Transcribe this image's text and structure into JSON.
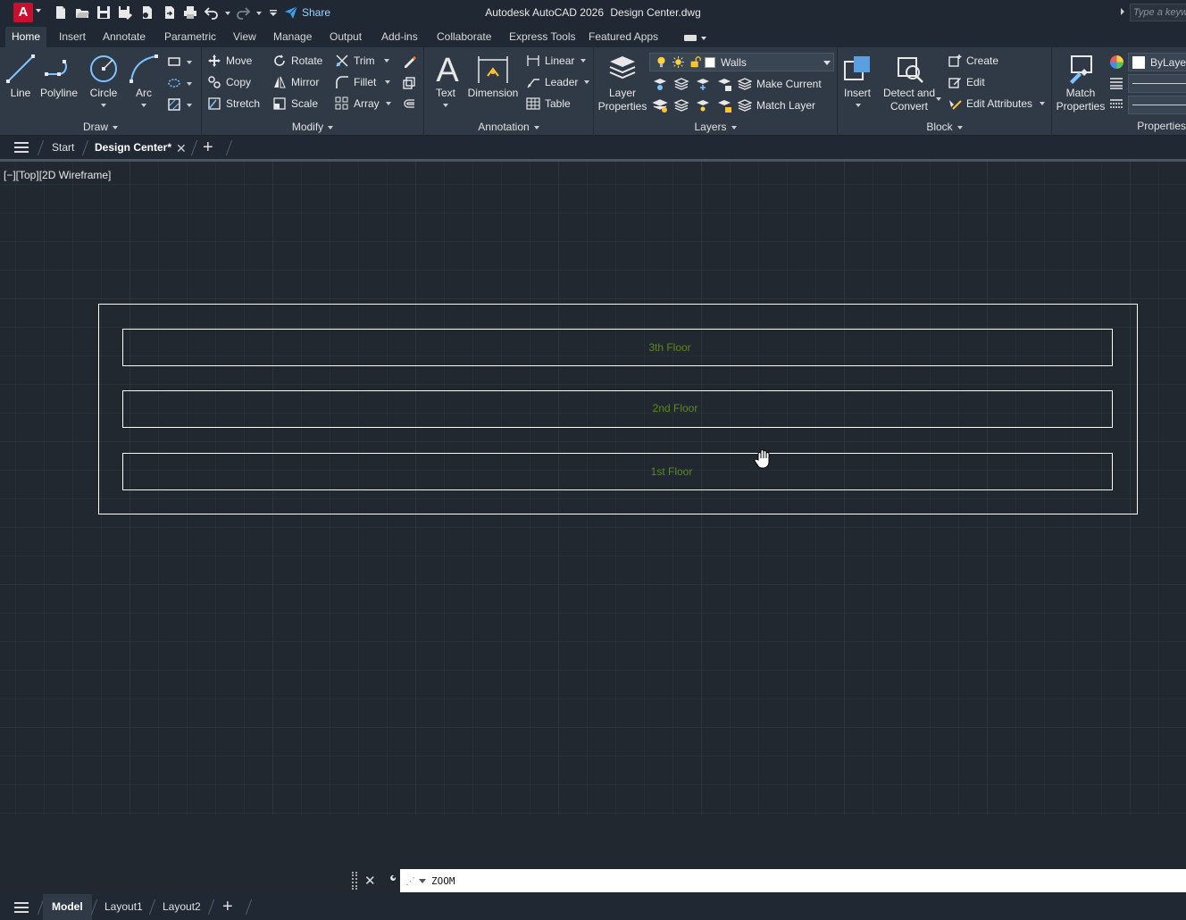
{
  "app": {
    "logo": "A",
    "title_app": "Autodesk AutoCAD 2026",
    "title_file": "Design Center.dwg",
    "share_label": "Share",
    "search_placeholder": "Type a keyword or phrase"
  },
  "ribbon_tabs": [
    "Home",
    "Insert",
    "Annotate",
    "Parametric",
    "View",
    "Manage",
    "Output",
    "Add-ins",
    "Collaborate",
    "Express Tools",
    "Featured Apps"
  ],
  "active_ribbon_tab": "Home",
  "draw": {
    "title": "Draw",
    "line": "Line",
    "polyline": "Polyline",
    "circle": "Circle",
    "arc": "Arc"
  },
  "modify": {
    "title": "Modify",
    "move": "Move",
    "rotate": "Rotate",
    "trim": "Trim",
    "copy": "Copy",
    "mirror": "Mirror",
    "fillet": "Fillet",
    "stretch": "Stretch",
    "scale": "Scale",
    "array": "Array"
  },
  "annotation": {
    "title": "Annotation",
    "text": "Text",
    "dimension": "Dimension",
    "linear": "Linear",
    "leader": "Leader",
    "table": "Table"
  },
  "layers": {
    "title": "Layers",
    "layer_properties_1": "Layer",
    "layer_properties_2": "Properties",
    "current_layer": "Walls",
    "make_current": "Make Current",
    "match_layer": "Match Layer"
  },
  "block": {
    "title": "Block",
    "insert": "Insert",
    "detect_1": "Detect and",
    "detect_2": "Convert",
    "create": "Create",
    "edit": "Edit",
    "edit_attributes": "Edit Attributes"
  },
  "properties": {
    "title": "Properties",
    "match_1": "Match",
    "match_2": "Properties",
    "color_value": "ByLayer"
  },
  "file_tabs": {
    "start": "Start",
    "active": "Design Center*"
  },
  "viewport_label": "[−][Top][2D Wireframe]",
  "drawing": {
    "floors": [
      "3th Floor",
      "2nd Floor",
      "1st Floor"
    ],
    "floor_text_color": "#5c8a1e",
    "line_color": "#ffffff"
  },
  "command_line": {
    "value": "ZOOM"
  },
  "layout_tabs": [
    "Model",
    "Layout1",
    "Layout2"
  ],
  "active_layout_tab": "Model",
  "colors": {
    "app_logo": "#c8102e",
    "ribbon_bg": "#303a47",
    "titlebar_bg": "#1f2833",
    "canvas_bg": "#212830",
    "share_accent": "#9fd3ff"
  }
}
